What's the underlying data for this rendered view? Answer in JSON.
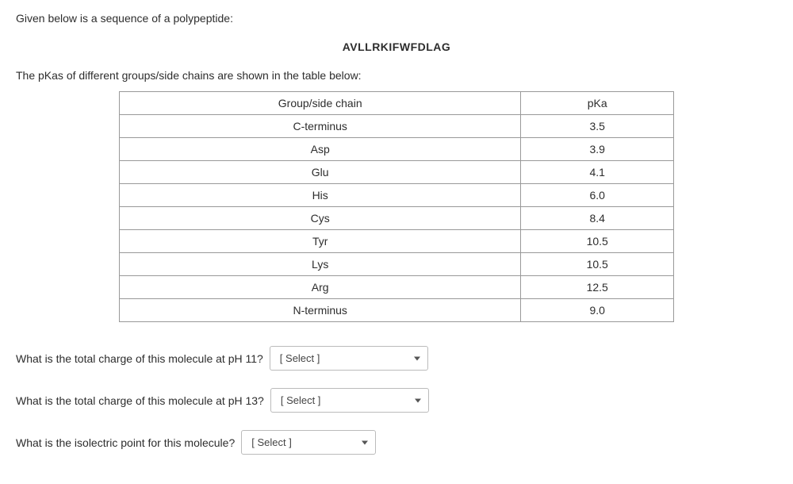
{
  "intro": "Given below is a sequence of a polypeptide:",
  "sequence": "AVLLRKIFWFDLAG",
  "sub": "The pKas of different groups/side chains are shown in the table below:",
  "table": {
    "headers": {
      "col1": "Group/side chain",
      "col2": "pKa"
    },
    "rows": [
      {
        "group": "C-terminus",
        "pka": "3.5"
      },
      {
        "group": "Asp",
        "pka": "3.9"
      },
      {
        "group": "Glu",
        "pka": "4.1"
      },
      {
        "group": "His",
        "pka": "6.0"
      },
      {
        "group": "Cys",
        "pka": "8.4"
      },
      {
        "group": "Tyr",
        "pka": "10.5"
      },
      {
        "group": "Lys",
        "pka": "10.5"
      },
      {
        "group": "Arg",
        "pka": "12.5"
      },
      {
        "group": "N-terminus",
        "pka": "9.0"
      }
    ]
  },
  "questions": {
    "q1": "What is the total charge of this molecule at pH 11?",
    "q2": "What is the total charge of this molecule at pH 13?",
    "q3": "What is the isolectric point for this molecule?"
  },
  "select_placeholder": "[ Select ]"
}
